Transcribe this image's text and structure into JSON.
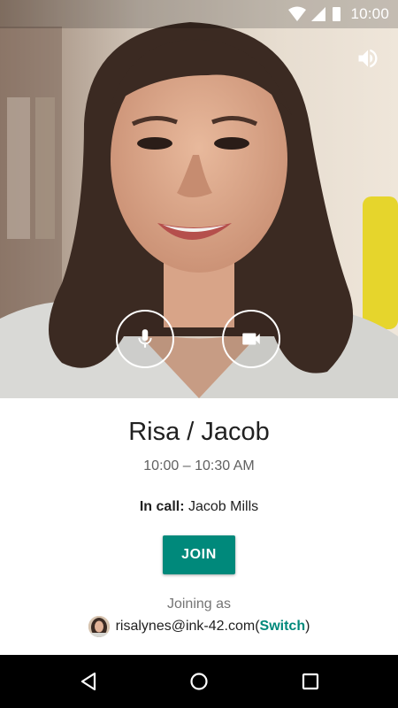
{
  "status_bar": {
    "time": "10:00"
  },
  "meeting": {
    "title": "Risa / Jacob",
    "time_range": "10:00 – 10:30 AM",
    "in_call_label": "In call:",
    "in_call_name": "Jacob Mills"
  },
  "actions": {
    "join_label": "JOIN"
  },
  "account": {
    "joining_as_label": "Joining as",
    "email": "risalynes@ink-42.com",
    "open_paren": " (",
    "switch_label": "Switch",
    "close_paren": ")"
  },
  "icons": {
    "speaker": "speaker-icon",
    "mic": "microphone-icon",
    "camera": "video-camera-icon",
    "wifi": "wifi-icon",
    "signal": "cell-signal-icon",
    "battery": "battery-icon",
    "back": "back-icon",
    "home": "home-icon",
    "recent": "recent-apps-icon"
  },
  "colors": {
    "accent": "#00897b",
    "nav_bar": "#000000",
    "title_text": "#212121"
  }
}
